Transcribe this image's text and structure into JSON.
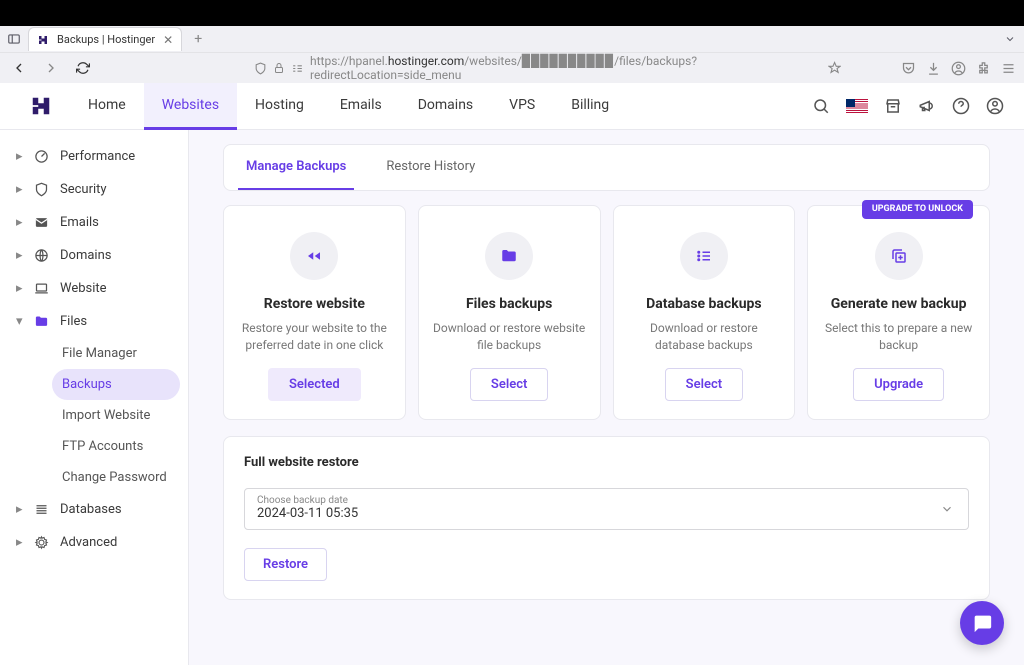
{
  "browser": {
    "tab_title": "Backups | Hostinger",
    "url_prefix": "https://hpanel.",
    "url_domain": "hostinger.com",
    "url_suffix": "/websites/▉▉▉▉▉▉▉▉▉▉/files/backups?redirectLocation=side_menu"
  },
  "topnav": {
    "items": [
      "Home",
      "Websites",
      "Hosting",
      "Emails",
      "Domains",
      "VPS",
      "Billing"
    ],
    "active_index": 1
  },
  "sidebar": {
    "items": [
      {
        "label": "Performance",
        "icon": "gauge"
      },
      {
        "label": "Security",
        "icon": "shield"
      },
      {
        "label": "Emails",
        "icon": "mail"
      },
      {
        "label": "Domains",
        "icon": "globe"
      },
      {
        "label": "Website",
        "icon": "laptop"
      },
      {
        "label": "Files",
        "icon": "folder",
        "expanded": true,
        "subitems": [
          {
            "label": "File Manager"
          },
          {
            "label": "Backups",
            "active": true
          },
          {
            "label": "Import Website"
          },
          {
            "label": "FTP Accounts"
          },
          {
            "label": "Change Password"
          }
        ]
      },
      {
        "label": "Databases",
        "icon": "database"
      },
      {
        "label": "Advanced",
        "icon": "gear"
      }
    ]
  },
  "panel": {
    "tabs": [
      {
        "label": "Manage Backups",
        "active": true
      },
      {
        "label": "Restore History",
        "active": false
      }
    ]
  },
  "cards": [
    {
      "title": "Restore website",
      "desc": "Restore your website to the preferred date in one click",
      "button": "Selected",
      "selected": true,
      "icon": "rewind"
    },
    {
      "title": "Files backups",
      "desc": "Download or restore website file backups",
      "button": "Select",
      "icon": "folder"
    },
    {
      "title": "Database backups",
      "desc": "Download or restore database backups",
      "button": "Select",
      "icon": "list"
    },
    {
      "title": "Generate new backup",
      "desc": "Select this to prepare a new backup",
      "button": "Upgrade",
      "icon": "plus-copy",
      "badge": "UPGRADE TO UNLOCK"
    }
  ],
  "restore": {
    "title": "Full website restore",
    "select_label": "Choose backup date",
    "select_value": "2024-03-11 05:35",
    "button": "Restore"
  }
}
